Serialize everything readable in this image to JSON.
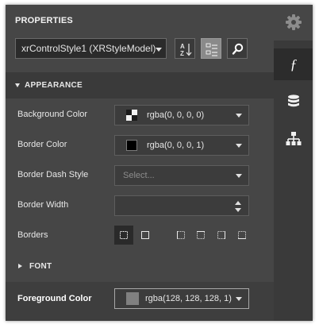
{
  "panel": {
    "title": "PROPERTIES",
    "style_selector": {
      "value": "xrControlStyle1 (XRStyleModel)"
    },
    "toolbar": [
      {
        "name": "sort-alphabetical-button",
        "active": false
      },
      {
        "name": "categorized-button",
        "active": true
      },
      {
        "name": "search-button",
        "active": false
      }
    ]
  },
  "rail": {
    "settings_icon": "gear-icon",
    "tabs": [
      {
        "name": "expressions-tab",
        "icon": "function-icon",
        "active": true
      },
      {
        "name": "field-list-tab",
        "icon": "database-icon",
        "active": false
      },
      {
        "name": "report-explorer-tab",
        "icon": "hierarchy-icon",
        "active": false
      }
    ]
  },
  "sections": {
    "appearance": {
      "label": "APPEARANCE",
      "expanded": true
    },
    "font": {
      "label": "FONT",
      "expanded": false
    }
  },
  "properties": {
    "background_color": {
      "label": "Background Color",
      "value": "rgba(0, 0, 0, 0)"
    },
    "border_color": {
      "label": "Border Color",
      "value": "rgba(0, 0, 0, 1)"
    },
    "border_dash_style": {
      "label": "Border Dash Style",
      "placeholder": "Select..."
    },
    "border_width": {
      "label": "Border Width",
      "value": ""
    },
    "borders": {
      "label": "Borders"
    },
    "foreground_color": {
      "label": "Foreground Color",
      "value": "rgba(128, 128, 128, 1)"
    }
  },
  "colors": {
    "panel_bg": "#464646",
    "rail_bg": "#3a3a3a",
    "border_swatch": "#000000",
    "foreground_swatch": "#808080"
  }
}
